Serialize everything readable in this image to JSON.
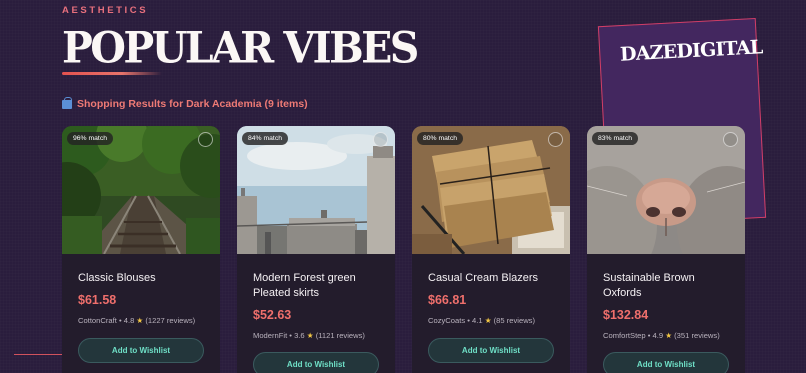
{
  "header": {
    "eyebrow": "AESTHETICS",
    "title": "POPULAR VIBES",
    "brand": "DAZEDIGITAL"
  },
  "results": {
    "icon": "shopping-bag-icon",
    "label": "Shopping Results for Dark Academia (9 items)"
  },
  "products": [
    {
      "match": "96% match",
      "name": "Classic Blouses",
      "price": "$61.58",
      "seller": "CottonCraft",
      "rating": "4.8",
      "reviews": "(1227 reviews)",
      "wishlist_label": "Add to Wishlist",
      "image": "railway-tracks-forest"
    },
    {
      "match": "84% match",
      "name": "Modern Forest green Pleated skirts",
      "price": "$52.63",
      "seller": "ModernFit",
      "rating": "3.6",
      "reviews": "(1121 reviews)",
      "wishlist_label": "Add to Wishlist",
      "image": "industrial-plant-tanks"
    },
    {
      "match": "80% match",
      "name": "Casual Cream Blazers",
      "price": "$66.81",
      "seller": "CozyCoats",
      "rating": "4.1",
      "reviews": "(85 reviews)",
      "wishlist_label": "Add to Wishlist",
      "image": "tied-paper-bundle-pen"
    },
    {
      "match": "83% match",
      "name": "Sustainable Brown Oxfords",
      "price": "$132.84",
      "seller": "ComfortStep",
      "rating": "4.9",
      "reviews": "(351 reviews)",
      "wishlist_label": "Add to Wishlist",
      "image": "cat-nose-closeup"
    }
  ],
  "colors": {
    "background": "#2a1d3d",
    "accent": "#ef6f6c",
    "button_text": "#6fe0c7",
    "card": "#231c2c"
  }
}
